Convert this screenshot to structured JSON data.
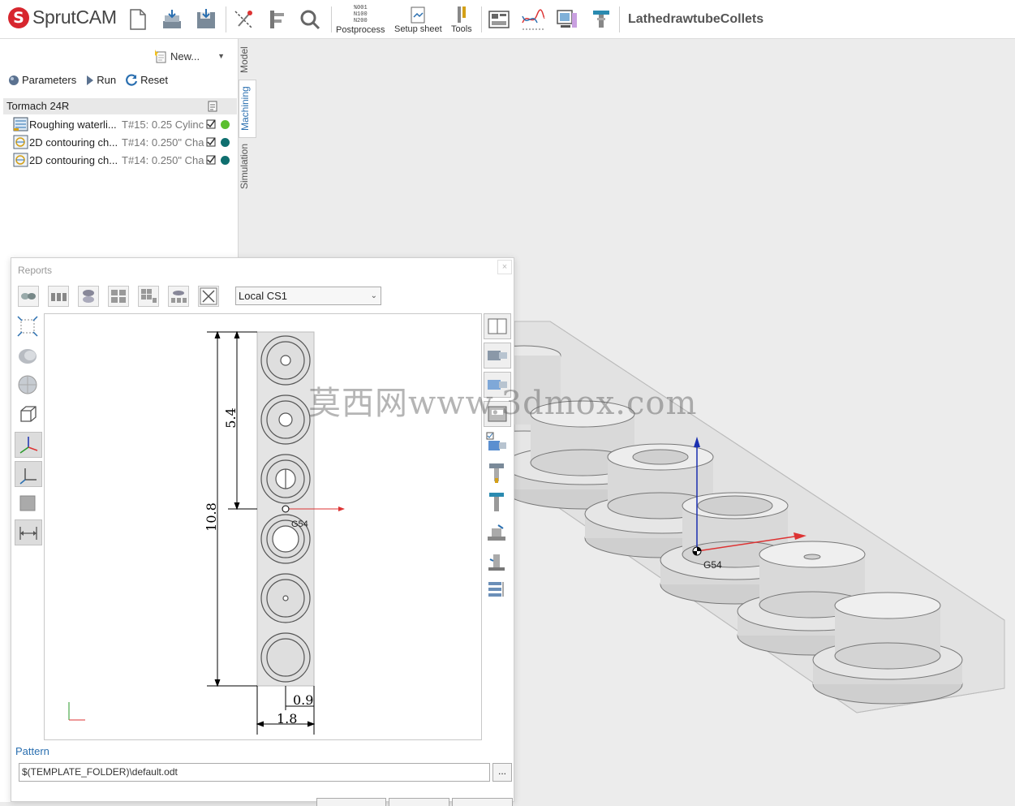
{
  "app": {
    "logo_letter": "S",
    "name": "SprutCAM",
    "project": "LathedrawtubeCollets"
  },
  "toolbar": {
    "buttons": [
      {
        "name": "new-file",
        "label": ""
      },
      {
        "name": "open-file",
        "label": ""
      },
      {
        "name": "save-file",
        "label": ""
      },
      {
        "name": "selection",
        "label": ""
      },
      {
        "name": "caliper",
        "label": ""
      },
      {
        "name": "zoom",
        "label": ""
      },
      {
        "name": "postprocess",
        "label": "Postprocess",
        "icon_text": "%001 N100 N200"
      },
      {
        "name": "setup-sheet",
        "label": "Setup sheet"
      },
      {
        "name": "tools",
        "label": "Tools"
      },
      {
        "name": "machine",
        "label": ""
      },
      {
        "name": "graph",
        "label": ""
      },
      {
        "name": "display",
        "label": ""
      },
      {
        "name": "holder",
        "label": ""
      }
    ]
  },
  "left_panel": {
    "new_label": "New...",
    "actions": {
      "parameters": "Parameters",
      "run": "Run",
      "reset": "Reset"
    },
    "machine": "Tormach 24R",
    "operations": [
      {
        "name": "Roughing waterli...",
        "tool": "T#15: 0.25 Cylinc",
        "status_color": "#5bbf2e"
      },
      {
        "name": "2D contouring ch...",
        "tool": "T#14: 0.250\" Cha",
        "status_color": "#0f6f6f"
      },
      {
        "name": "2D contouring ch...",
        "tool": "T#14: 0.250\" Cha",
        "status_color": "#0f6f6f"
      }
    ],
    "tabs": [
      "Model",
      "Machining",
      "Simulation"
    ],
    "active_tab": "Machining"
  },
  "viewport": {
    "cs_label": "G54"
  },
  "reports": {
    "title": "Reports",
    "close": "×",
    "coordinate_system": "Local CS1",
    "drawing": {
      "dim_total": "10.8",
      "dim_half": "5.4",
      "dim_width": "1.8",
      "dim_half_width": "0.9",
      "cs_label": "G54"
    },
    "pattern_label": "Pattern",
    "pattern_value": "$(TEMPLATE_FOLDER)\\default.odt",
    "browse": "..."
  },
  "watermark": "莫西网www.3dmox.com"
}
